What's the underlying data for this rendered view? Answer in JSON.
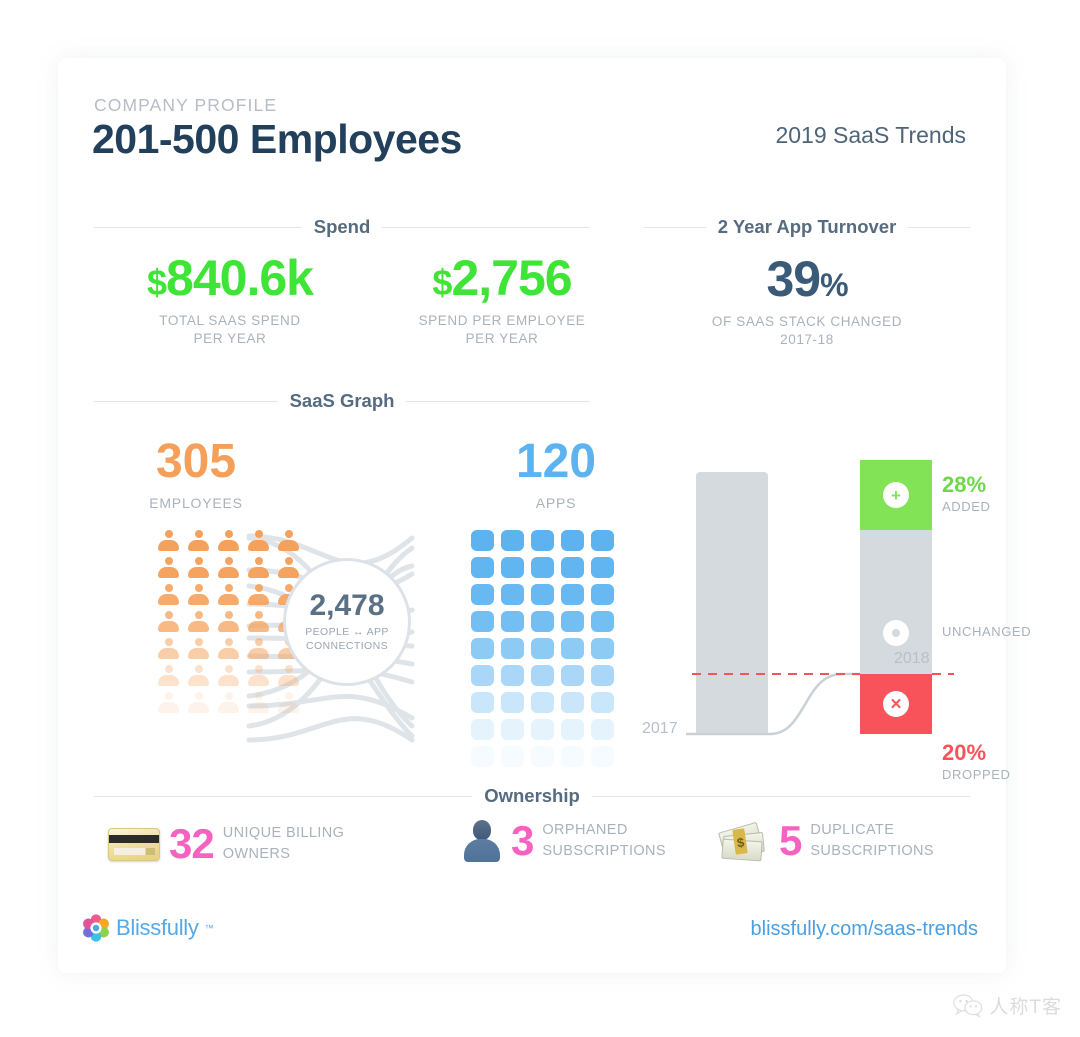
{
  "header": {
    "kicker": "COMPANY PROFILE",
    "title": "201-500 Employees",
    "report": "2019 SaaS Trends"
  },
  "sections": {
    "spend": "Spend",
    "turnover": "2 Year App Turnover",
    "saas_graph": "SaaS Graph",
    "ownership": "Ownership"
  },
  "spend": {
    "total": {
      "currency": "$",
      "value": "840.6k",
      "caption": "TOTAL SAAS SPEND\nPER YEAR"
    },
    "per_employee": {
      "currency": "$",
      "value": "2,756",
      "caption": "SPEND PER EMPLOYEE\nPER YEAR"
    }
  },
  "turnover_stat": {
    "value": "39",
    "unit": "%",
    "caption": "OF SAAS STACK CHANGED\n2017-18"
  },
  "saas_graph": {
    "employees_value": "305",
    "employees_label": "EMPLOYEES",
    "apps_value": "120",
    "apps_label": "APPS",
    "connections_value": "2,478",
    "connections_label": "PEOPLE ↔ APP\nCONNECTIONS"
  },
  "ownership": [
    {
      "icon": "credit-card-icon",
      "value": "32",
      "label": "UNIQUE BILLING\nOWNERS"
    },
    {
      "icon": "person-silhouette-icon",
      "value": "3",
      "label": "ORPHANED\nSUBSCRIPTIONS"
    },
    {
      "icon": "money-stack-icon",
      "value": "5",
      "label": "DUPLICATE\nSUBSCRIPTIONS"
    }
  ],
  "footer": {
    "brand": "Blissfully",
    "trademark": "™",
    "link": "blissfully.com/saas-trends"
  },
  "watermark": {
    "text": "人称T客",
    "icon": "wechat-icon"
  },
  "colors": {
    "green": "#3ee536",
    "navy": "#3a5a77",
    "orange": "#f5a05a",
    "blue": "#5cb3f0",
    "pink": "#f562c0",
    "red": "#f8535b",
    "added_green": "#82e356",
    "gray_bar": "#d4dade"
  },
  "chart_data": {
    "type": "bar",
    "title": "2 Year App Turnover",
    "categories": [
      "2017",
      "2018"
    ],
    "axis_labels": {
      "left": "2017",
      "right": "2018"
    },
    "segments": [
      {
        "name": "ADDED",
        "value": 28,
        "unit": "%",
        "color": "#82e356",
        "icon": "plus-icon",
        "label": "28%"
      },
      {
        "name": "UNCHANGED",
        "value": 52,
        "unit": "%",
        "color": "#d4dade",
        "icon": "dot-icon",
        "label": ""
      },
      {
        "name": "DROPPED",
        "value": 20,
        "unit": "%",
        "color": "#f8535b",
        "icon": "x-icon",
        "label": "20%"
      }
    ],
    "baseline_2017": {
      "name": "2017 stack",
      "value": 100,
      "color": "#d4dade"
    },
    "grid": false,
    "legend": "inline-right",
    "annotation": "39% of SaaS stack changed 2017-18"
  }
}
